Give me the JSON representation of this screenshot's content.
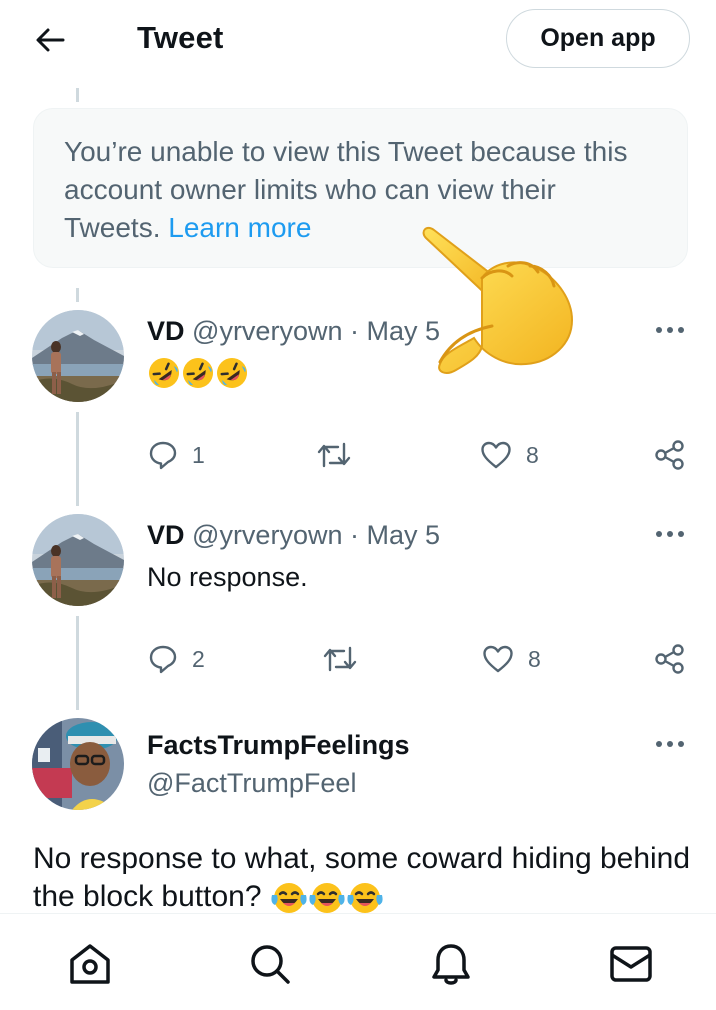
{
  "header": {
    "title": "Tweet",
    "open_app_label": "Open app",
    "back_icon": "back-arrow-icon"
  },
  "notice": {
    "text": "You’re unable to view this Tweet because this account owner limits who can view their Tweets.",
    "link_label": "Learn more"
  },
  "tweets": [
    {
      "name": "VD",
      "handle": "@yrveryown",
      "separator": "·",
      "date": "May 5",
      "text_emoji": "rolling-on-floor-laughing x3",
      "replies": "1",
      "likes": "8"
    },
    {
      "name": "VD",
      "handle": "@yrveryown",
      "separator": "·",
      "date": "May 5",
      "text": "No response.",
      "replies": "2",
      "likes": "8"
    },
    {
      "name": "FactsTrumpFeelings",
      "handle": "@FactTrumpFeel",
      "text": "No response to what, some coward hiding behind the block button?",
      "text_emoji": "face-with-tears-of-joy x3"
    }
  ],
  "nav": {
    "items": [
      "home-icon",
      "search-icon",
      "notifications-icon",
      "messages-icon"
    ]
  },
  "colors": {
    "link": "#1d9bf0",
    "secondary_text": "#536471",
    "border": "#cfd9de",
    "notice_bg": "#f7f9f9"
  }
}
